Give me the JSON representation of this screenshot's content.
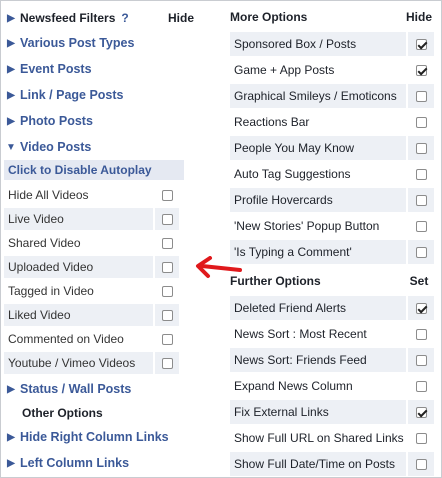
{
  "left": {
    "header": {
      "title": "Newsfeed Filters",
      "help": "?",
      "hide": "Hide"
    },
    "sections_top": [
      "Various Post Types",
      "Event Posts",
      "Link / Page Posts",
      "Photo Posts",
      "Video Posts"
    ],
    "autoplay": "Click to Disable Autoplay",
    "video_rows": [
      {
        "label": "Hide All Videos",
        "checked": false
      },
      {
        "label": "Live Video",
        "checked": false
      },
      {
        "label": "Shared Video",
        "checked": false
      },
      {
        "label": "Uploaded Video",
        "checked": false
      },
      {
        "label": "Tagged in Video",
        "checked": false
      },
      {
        "label": "Liked Video",
        "checked": false
      },
      {
        "label": "Commented on Video",
        "checked": false
      },
      {
        "label": "Youtube / Vimeo Videos",
        "checked": false
      }
    ],
    "status": "Status / Wall Posts",
    "other": "Other Options",
    "hide_right": "Hide Right Column Links",
    "left_links": "Left Column Links"
  },
  "right": {
    "more": {
      "title": "More Options",
      "hide": "Hide"
    },
    "more_rows": [
      {
        "label": "Sponsored Box / Posts",
        "checked": true
      },
      {
        "label": "Game + App Posts",
        "checked": true
      },
      {
        "label": "Graphical Smileys / Emoticons",
        "checked": false
      },
      {
        "label": "Reactions Bar",
        "checked": false
      },
      {
        "label": "People You May Know",
        "checked": false
      },
      {
        "label": "Auto Tag Suggestions",
        "checked": false
      },
      {
        "label": "Profile Hovercards",
        "checked": false
      },
      {
        "label": "'New Stories' Popup Button",
        "checked": false
      },
      {
        "label": "'Is Typing a Comment'",
        "checked": false
      }
    ],
    "further": {
      "title": "Further Options",
      "set": "Set"
    },
    "further_rows": [
      {
        "label": "Deleted Friend Alerts",
        "checked": true
      },
      {
        "label": "News Sort : Most Recent",
        "checked": false
      },
      {
        "label": "News Sort: Friends Feed",
        "checked": false
      },
      {
        "label": "Expand News Column",
        "checked": false
      },
      {
        "label": "Fix External Links",
        "checked": true
      },
      {
        "label": "Show Full URL on Shared Links",
        "checked": false
      },
      {
        "label": "Show Full Date/Time on Posts",
        "checked": false
      }
    ]
  },
  "colors": {
    "link": "#3b5998",
    "row": "#edf0f5",
    "arrow": "#e0191c"
  }
}
